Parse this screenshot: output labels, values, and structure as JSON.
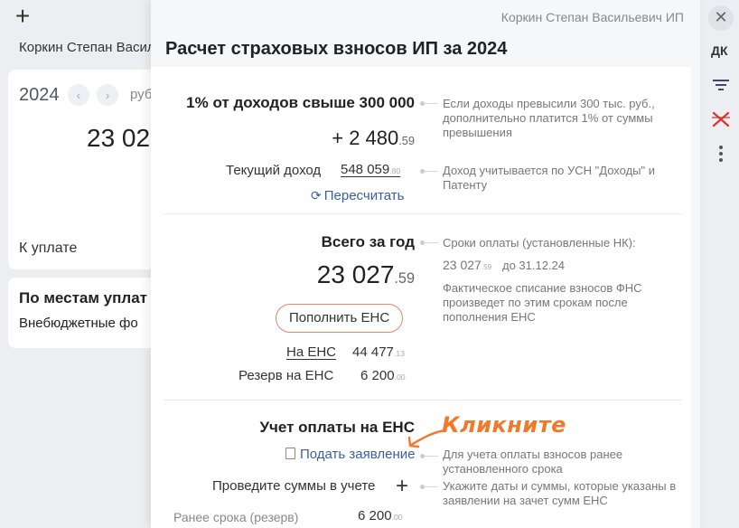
{
  "background": {
    "add_glyph": "+",
    "user_name": "Коркин Степан Васил",
    "year": "2024",
    "prev_glyph": "‹",
    "next_glyph": "›",
    "currency": "руб",
    "amount": "23 02",
    "to_pay_label": "К уплате",
    "places_title": "По местам уплат",
    "funds_label": "Внебюджетные фо"
  },
  "rail": {
    "close_glyph": "✕",
    "user_initials": "ДК",
    "icons": [
      "filter-icon",
      "cross-red-icon",
      "more-vertical-icon"
    ]
  },
  "panel": {
    "owner": "Коркин Степан Васильевич ИП",
    "title": "Расчет страховых взносов ИП за 2024",
    "extra": {
      "heading": "1% от доходов свыше 300 000",
      "amount_int": "+ 2 480",
      "amount_kop": ".59",
      "income_label": "Текущий доход",
      "income_int": "548 059",
      "income_kop": ".80",
      "recalc_label": "Пересчитать",
      "note1": "Если доходы превысили 300 тыс. руб., дополнительно платится 1% от суммы превышения",
      "note2": "Доход учитывается по УСН \"Доходы\" и Патенту"
    },
    "total": {
      "heading": "Всего за год",
      "amount_int": "23 027",
      "amount_kop": ".59",
      "topup_button": "Пополнить ЕНС",
      "ens_label": "На ЕНС",
      "ens_int": "44 477",
      "ens_kop": ".13",
      "reserve_label": "Резерв на ЕНС",
      "reserve_int": "6 200",
      "reserve_kop": ".00",
      "deadline_title": "Сроки оплаты (установленные НК):",
      "deadline_int": "23 027",
      "deadline_kop": ".59",
      "deadline_date": "до 31.12.24",
      "deadline_note": "Фактическое списание взносов ФНС произведет по этим срокам после пополнения ЕНС"
    },
    "accounting": {
      "heading": "Учет оплаты на ЕНС",
      "callout": "Кликните",
      "apply_link": "Подать заявление",
      "apply_note": "Для учета оплаты взносов ранее установленного срока",
      "post_label": "Проведите суммы в учете",
      "post_note": "Укажите даты и суммы, которые указаны в заявлении на зачет сумм ЕНС",
      "early_label": "Ранее срока (резерв)",
      "early_int": "6 200",
      "early_kop": ".00"
    }
  },
  "colors": {
    "accent_orange": "#f07a2a",
    "link_blue": "#3a5fa0",
    "danger_red": "#d9342b",
    "button_border": "#e9836b"
  }
}
